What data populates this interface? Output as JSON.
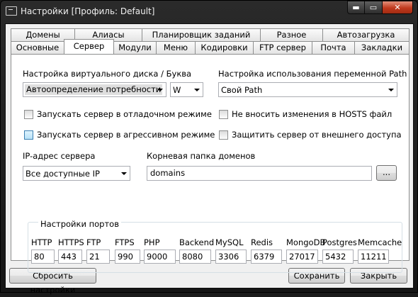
{
  "window": {
    "title": "Настройки [Профиль: Default]",
    "min_label": "▬",
    "max_label": "▭",
    "close_label": "✕"
  },
  "tabs_row1": [
    "Домены",
    "Алиасы",
    "Планировщик заданий",
    "Разное",
    "Автозагрузка"
  ],
  "tabs_row2": [
    "Основные",
    "Сервер",
    "Модули",
    "Меню",
    "Кодировки",
    "FTP сервер",
    "Почта",
    "Закладки"
  ],
  "active_tab": "Сервер",
  "server": {
    "vdisk_label": "Настройка виртуального диска / Буква",
    "vdisk_value": "Автоопределение потребности",
    "vdisk_letter": "W",
    "path_label": "Настройка использования переменной Path",
    "path_value": "Свой Path",
    "debug_mode": "Запускать сервер в отладочном режиме",
    "aggressive_mode": "Запускать сервер в агрессивном режиме",
    "no_hosts": "Не вносить изменения в HOSTS файл",
    "protect": "Защитить сервер от внешнего доступа",
    "ip_label": "IP-адрес сервера",
    "ip_value": "Все доступные IP",
    "root_label": "Корневая папка доменов",
    "root_value": "domains",
    "browse_label": "..."
  },
  "ports": {
    "title": "Настройки портов",
    "items": [
      {
        "label": "HTTP",
        "value": "80"
      },
      {
        "label": "HTTPS",
        "value": "443"
      },
      {
        "label": "FTP",
        "value": "21"
      },
      {
        "label": "FTPS",
        "value": "990"
      },
      {
        "label": "PHP",
        "value": "9000"
      },
      {
        "label": "Backend",
        "value": "8080"
      },
      {
        "label": "MySQL",
        "value": "3306"
      },
      {
        "label": "Redis",
        "value": "6379"
      },
      {
        "label": "MongoDB",
        "value": "27017"
      },
      {
        "label": "Postgres",
        "value": "5432"
      },
      {
        "label": "Memcache",
        "value": "11211"
      }
    ]
  },
  "buttons": {
    "reset": "Сбросить настройки",
    "save": "Сохранить",
    "close": "Закрыть"
  }
}
